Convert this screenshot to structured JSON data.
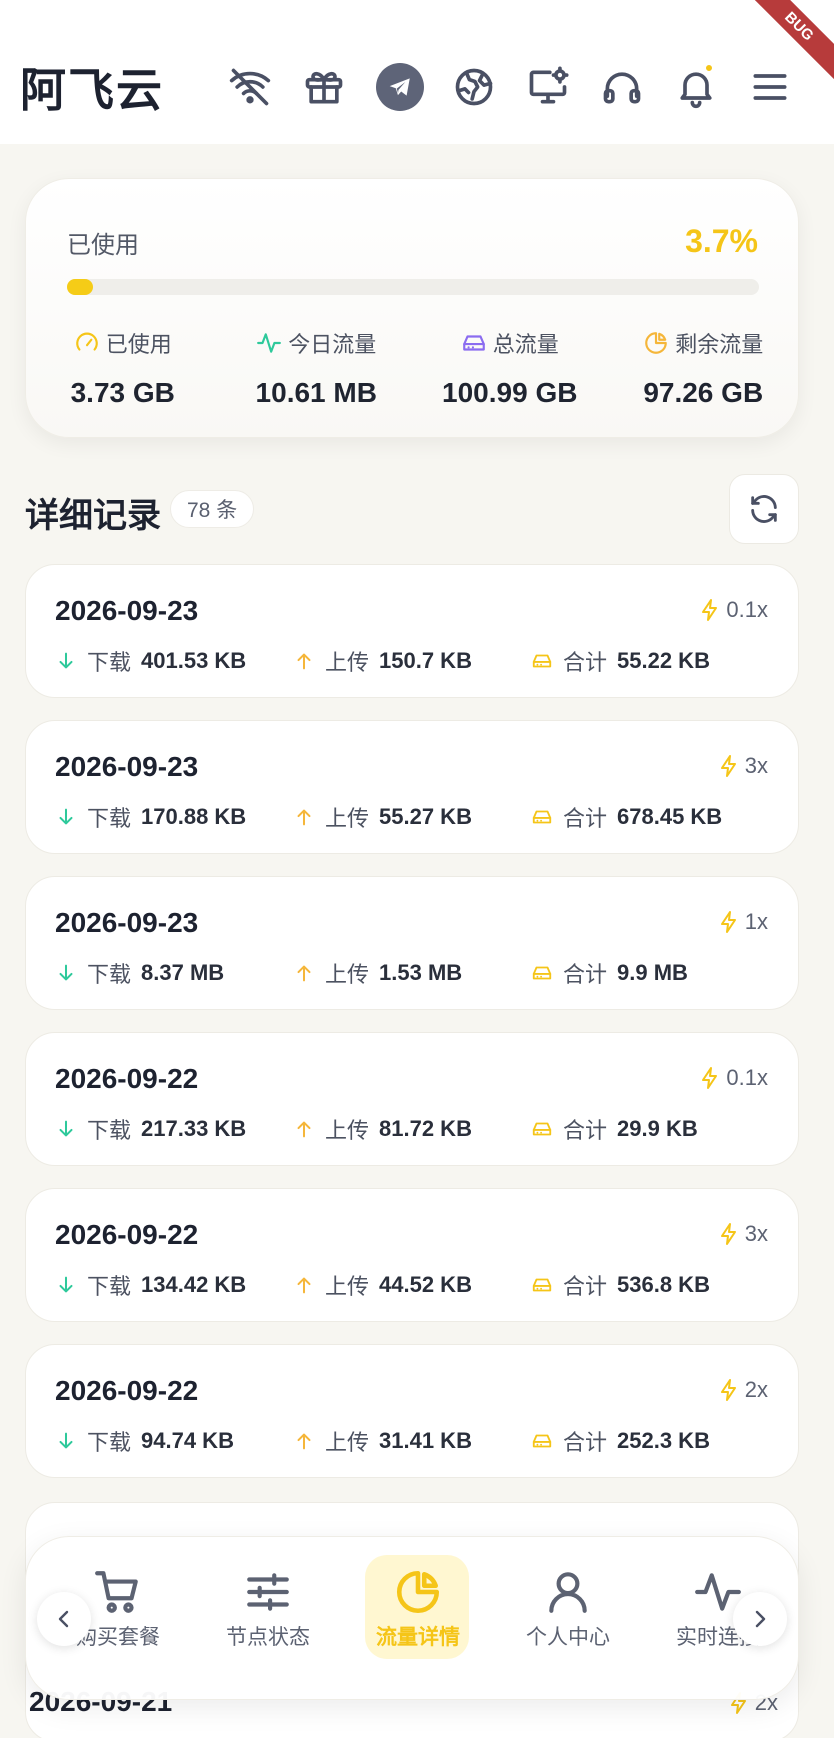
{
  "header": {
    "title": "阿飞云",
    "debug_ribbon": "BUG",
    "icons": [
      "wifi-off-icon",
      "gift-icon",
      "telegram-icon",
      "globe-icon",
      "monitor-settings-icon",
      "headphones-icon",
      "bell-icon",
      "menu-icon"
    ]
  },
  "usage": {
    "label": "已使用",
    "percent_text": "3.7%",
    "percent": 3.7,
    "accent_color": "#f5c518",
    "stats": [
      {
        "label": "已使用",
        "value": "3.73 GB",
        "icon": "gauge-icon",
        "color": "#f5c518"
      },
      {
        "label": "今日流量",
        "value": "10.61 MB",
        "icon": "activity-icon",
        "color": "#2ec99b"
      },
      {
        "label": "总流量",
        "value": "100.99 GB",
        "icon": "drive-icon",
        "color": "#8b6cf0"
      },
      {
        "label": "剩余流量",
        "value": "97.26 GB",
        "icon": "pie-icon",
        "color": "#f5b63a"
      }
    ]
  },
  "records": {
    "title": "详细记录",
    "count": "78 条",
    "labels": {
      "download": "下载",
      "upload": "上传",
      "total": "合计"
    },
    "items": [
      {
        "date": "2026-09-23",
        "mult": "0.1x",
        "download": "401.53 KB",
        "upload": "150.7 KB",
        "total": "55.22 KB"
      },
      {
        "date": "2026-09-23",
        "mult": "3x",
        "download": "170.88 KB",
        "upload": "55.27 KB",
        "total": "678.45 KB"
      },
      {
        "date": "2026-09-23",
        "mult": "1x",
        "download": "8.37 MB",
        "upload": "1.53 MB",
        "total": "9.9 MB"
      },
      {
        "date": "2026-09-22",
        "mult": "0.1x",
        "download": "217.33 KB",
        "upload": "81.72 KB",
        "total": "29.9 KB"
      },
      {
        "date": "2026-09-22",
        "mult": "3x",
        "download": "134.42 KB",
        "upload": "44.52 KB",
        "total": "536.8 KB"
      },
      {
        "date": "2026-09-22",
        "mult": "2x",
        "download": "94.74 KB",
        "upload": "31.41 KB",
        "total": "252.3 KB"
      }
    ],
    "partial": {
      "date": "2026-09-21",
      "mult": "2x"
    }
  },
  "nav": {
    "items": [
      {
        "label": "购买套餐",
        "icon": "cart-icon"
      },
      {
        "label": "节点状态",
        "icon": "sliders-icon"
      },
      {
        "label": "流量详情",
        "icon": "pie-chart-icon",
        "active": true
      },
      {
        "label": "个人中心",
        "icon": "user-icon"
      },
      {
        "label": "实时连接",
        "icon": "activity-icon"
      }
    ]
  }
}
